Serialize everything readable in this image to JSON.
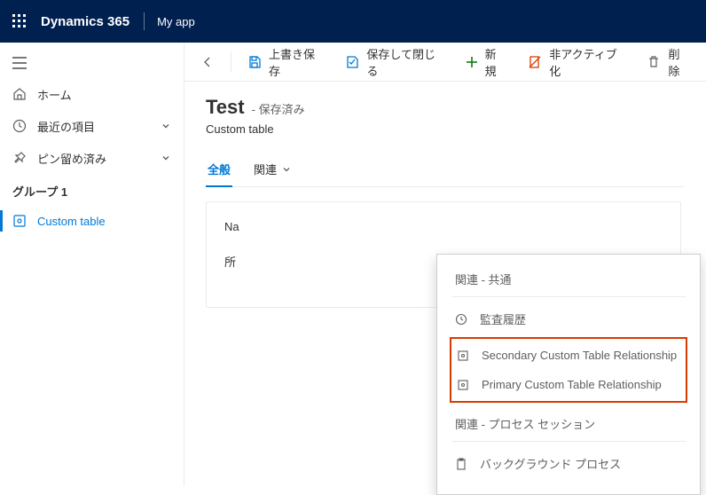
{
  "topbar": {
    "brand": "Dynamics 365",
    "app": "My app"
  },
  "sidebar": {
    "items": [
      {
        "label": "ホーム",
        "icon": "home"
      },
      {
        "label": "最近の項目",
        "icon": "clock",
        "expandable": true
      },
      {
        "label": "ピン留め済み",
        "icon": "pin",
        "expandable": true
      }
    ],
    "group_label": "グループ 1",
    "active_item": {
      "label": "Custom table",
      "icon": "entity"
    }
  },
  "commandbar": {
    "back": "",
    "save": "上書き保存",
    "save_close": "保存して閉じる",
    "new": "新規",
    "deactivate": "非アクティブ化",
    "delete": "削除"
  },
  "record": {
    "title": "Test",
    "status_prefix": "- ",
    "status": "保存済み",
    "subtitle": "Custom table"
  },
  "tabs": {
    "general": "全般",
    "related": "関連"
  },
  "form": {
    "name_label": "Na",
    "owner_label": "所"
  },
  "popup": {
    "section_common": "関連 - 共通",
    "audit": "監査履歴",
    "secondary": "Secondary Custom Table Relationship",
    "primary": "Primary Custom Table Relationship",
    "section_process": "関連 - プロセス セッション",
    "background": "バックグラウンド プロセス"
  }
}
